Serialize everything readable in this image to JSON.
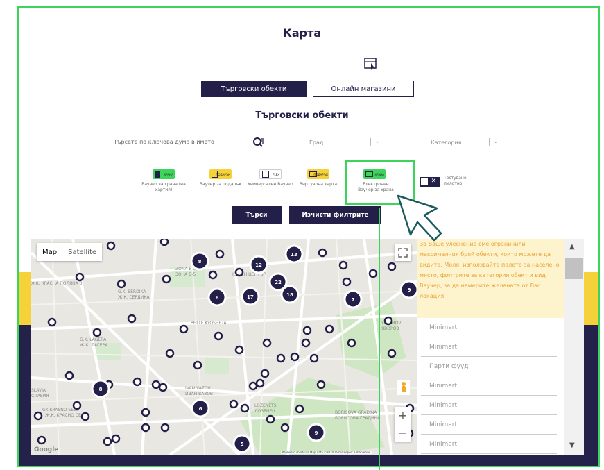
{
  "page": {
    "title": "Карта",
    "tabs": [
      {
        "label": "Търговски обекти",
        "active": true
      },
      {
        "label": "Онлайн магазини",
        "active": false
      }
    ],
    "subtitle": "Търговски обекти"
  },
  "filters": {
    "search_placeholder": "Търсете по ключова дума в името",
    "city_placeholder": "Град",
    "category_placeholder": "Категория",
    "vouchers": [
      {
        "chip": "ХРАНА",
        "label": "Ваучер за храна (на хартия)",
        "color": "#3ed35a",
        "icon": "food-icon"
      },
      {
        "chip": "ПОДАРЪК",
        "label": "Ваучер за подарък",
        "color": "#f6d23a",
        "icon": "gift-icon"
      },
      {
        "chip": "FLEX",
        "label": "Универсален Ваучер",
        "color": "#ffffff",
        "icon": "flex-icon"
      },
      {
        "chip": "ПОДАРЪК",
        "label": "Виртуална карта",
        "color": "#f6d23a",
        "icon": "card-icon"
      },
      {
        "chip": "ХРАНА",
        "label": "Електронен Ваучер за храна",
        "color": "#3ed35a",
        "icon": "card-icon"
      }
    ],
    "toggle_label": "Тестуване пилотно",
    "search_button": "Търси",
    "clear_button": "Изчисти филтрите"
  },
  "map": {
    "type_map": "Map",
    "type_satellite": "Satellite",
    "google": "Google",
    "attribution": "Keyboard shortcuts   Map data ©2024   Terms   Report a map error",
    "zoom_in": "+",
    "zoom_out": "−",
    "districts": [
      "ЖК. КРАСНА ПОЛЯНА 3",
      "G.K. SERDIKA",
      "Ж.К. СЕРДИКА",
      "PETTE KYOSHETA",
      "G.K. LAGERA",
      "Ж.К. ЛАГЕРА",
      "IVAN VAZOV",
      "ИВАН ВАЗОВ",
      "GK KRASNO SELO",
      "Ж.К. КРАСНО СЕЛО",
      "LOZENETS",
      "ЛОЗЕНЕЦ",
      "BORISOVA GRADINA",
      "БОРИСОВА ГРАДИНА",
      "SLAVIA",
      "СЛАВИЯ",
      "YAVOROV",
      "ЯВОРОВ",
      "ZONA B-5",
      "ЗОНА Б-5",
      "ЮЖЕН ЦЕНТЪР"
    ],
    "clusters": [
      "8",
      "12",
      "13",
      "22",
      "6",
      "17",
      "18",
      "7",
      "9",
      "8",
      "6",
      "9",
      "5"
    ]
  },
  "results": {
    "notice": "За Ваше улеснение сме ограничили максималния брой обекти, които можете да видите. Моля, използвайте полето за населено място, филтрите за категория обект и вид Ваучер, за да намерите желаната от Вас локация.",
    "items": [
      "Minimart",
      "Minimart",
      "Парти фууд",
      "Minimart",
      "Minimart",
      "Minimart",
      "Minimart"
    ]
  },
  "colors": {
    "navy": "#221f48",
    "green": "#3ed35a",
    "yellow": "#f6d23a",
    "notice_text": "#e8a43a"
  }
}
